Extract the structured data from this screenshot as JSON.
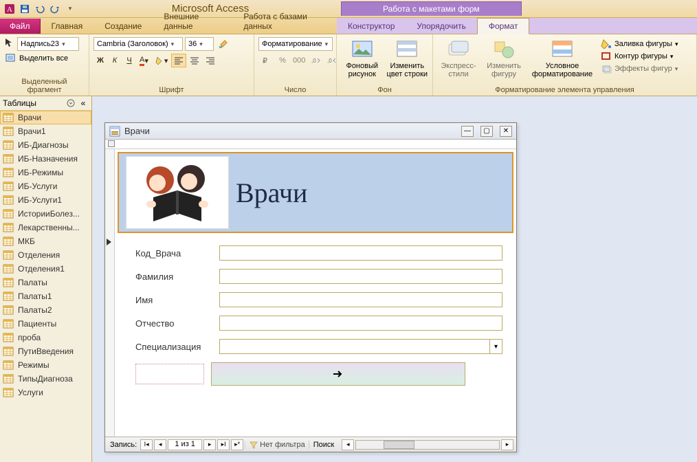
{
  "app": {
    "title": "Microsoft Access",
    "context_title": "Работа с макетами форм"
  },
  "tabs": {
    "file": "Файл",
    "items": [
      "Главная",
      "Создание",
      "Внешние данные",
      "Работа с базами данных"
    ],
    "ctx": [
      "Конструктор",
      "Упорядочить",
      "Формат"
    ],
    "active": "Формат"
  },
  "ribbon": {
    "sel_group": "Выделенный фрагмент",
    "sel_combo": "Надпись23",
    "sel_all": "Выделить все",
    "font_group": "Шрифт",
    "font_name": "Cambria (Заголовок)",
    "font_size": "36",
    "format_btn": "Форматирование",
    "number_group": "Число",
    "bg_group": "Фон",
    "bg_image": "Фоновый рисунок",
    "bg_rowcolor": "Изменить цвет строки",
    "ctrlfmt_group": "Форматирование элемента управления",
    "express": "Экспресс-стили",
    "change_shape": "Изменить фигуру",
    "conditional": "Условное форматирование",
    "fill": "Заливка фигуры",
    "outline": "Контур фигуры",
    "effects": "Эффекты фигур"
  },
  "nav": {
    "header": "Таблицы",
    "items": [
      "Врачи",
      "Врачи1",
      "ИБ-Диагнозы",
      "ИБ-Назначения",
      "ИБ-Режимы",
      "ИБ-Услуги",
      "ИБ-Услуги1",
      "ИсторииБолез...",
      "Лекарственны...",
      "МКБ",
      "Отделения",
      "Отделения1",
      "Палаты",
      "Палаты1",
      "Палаты2",
      "Пациенты",
      "проба",
      "ПутиВведения",
      "Режимы",
      "ТипыДиагноза",
      "Услуги"
    ],
    "selected": 0
  },
  "form": {
    "title": "Врачи",
    "header_label": "Врачи",
    "fields": {
      "code": "Код_Врача",
      "lastname": "Фамилия",
      "firstname": "Имя",
      "patronymic": "Отчество",
      "spec": "Специализация"
    },
    "record_nav": {
      "label": "Запись:",
      "pos": "1 из 1",
      "filter": "Нет фильтра",
      "search": "Поиск"
    }
  }
}
